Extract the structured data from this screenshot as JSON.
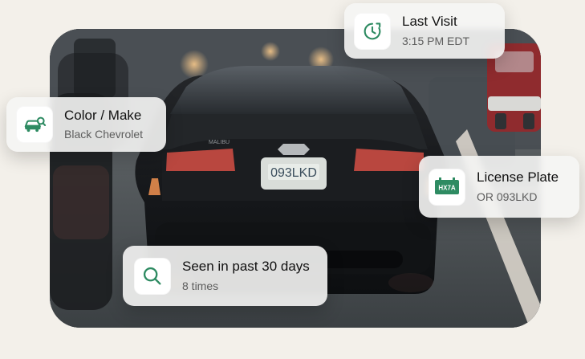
{
  "cards": {
    "last_visit": {
      "icon": "clock-refresh-icon",
      "title": "Last Visit",
      "value": "3:15 PM EDT"
    },
    "color_make": {
      "icon": "car-search-icon",
      "title": "Color / Make",
      "value": "Black Chevrolet"
    },
    "license_plate": {
      "icon": "license-plate-icon",
      "icon_text": "HX7A",
      "title": "License Plate",
      "value": "OR 093LKD"
    },
    "seen_recently": {
      "icon": "search-icon",
      "title": "Seen in past 30 days",
      "value": "8 times"
    }
  },
  "photo": {
    "plate_text": "093LKD",
    "brand_text": "MALIBU"
  },
  "colors": {
    "accent": "#2e8b62",
    "card_bg": "#f5f5f4",
    "page_bg": "#f3f0ea"
  }
}
